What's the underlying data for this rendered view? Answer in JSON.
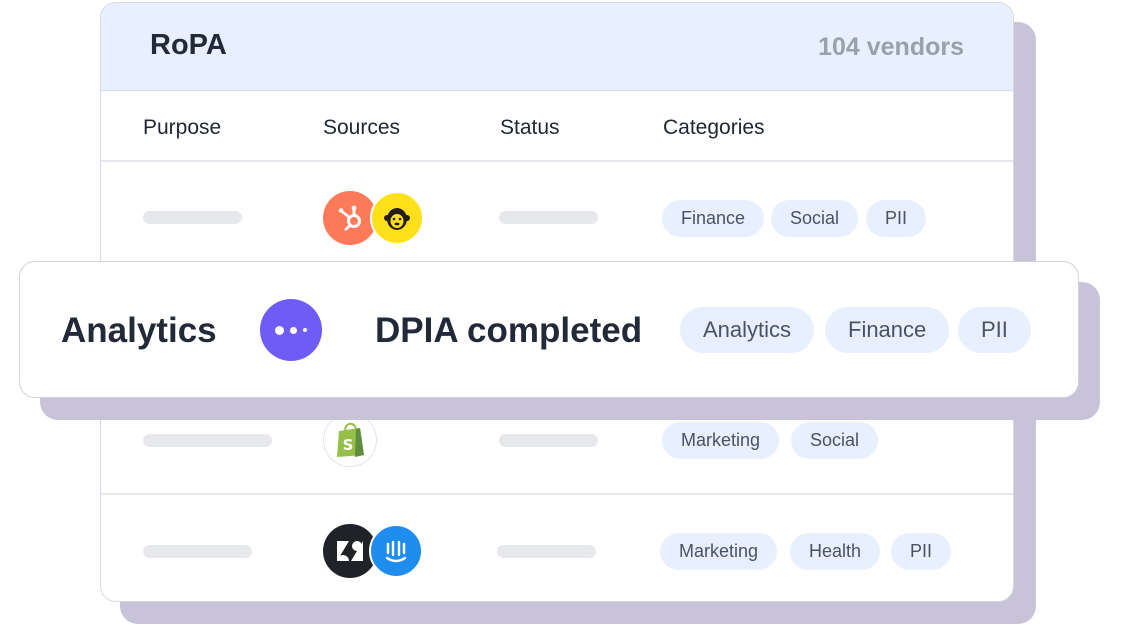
{
  "card": {
    "title": "RoPA",
    "vendor_count": "104 vendors",
    "columns": [
      "Purpose",
      "Sources",
      "Status",
      "Categories"
    ]
  },
  "rows": [
    {
      "sources": [
        "hubspot-icon",
        "mailchimp-icon"
      ],
      "categories": [
        "Finance",
        "Social",
        "PII"
      ]
    },
    {
      "sources": [
        "shopify-icon"
      ],
      "categories": [
        "Marketing",
        "Social"
      ]
    },
    {
      "sources": [
        "zendesk-icon",
        "intercom-icon"
      ],
      "categories": [
        "Marketing",
        "Health",
        "PII"
      ]
    }
  ],
  "highlight": {
    "purpose": "Analytics",
    "source_icon": "more-dots-icon",
    "status": "DPIA completed",
    "categories": [
      "Analytics",
      "Finance",
      "PII"
    ]
  },
  "colors": {
    "header_bg": "#e8f0fd",
    "tag_bg": "#e8f0fd",
    "accent_purple": "#6d5cf6",
    "shadow": "#c9c3d9",
    "hubspot": "#ff7a59",
    "mailchimp": "#ffe01b",
    "shopify": "#95bf47",
    "zendesk": "#03363d",
    "intercom": "#1f8ded"
  }
}
